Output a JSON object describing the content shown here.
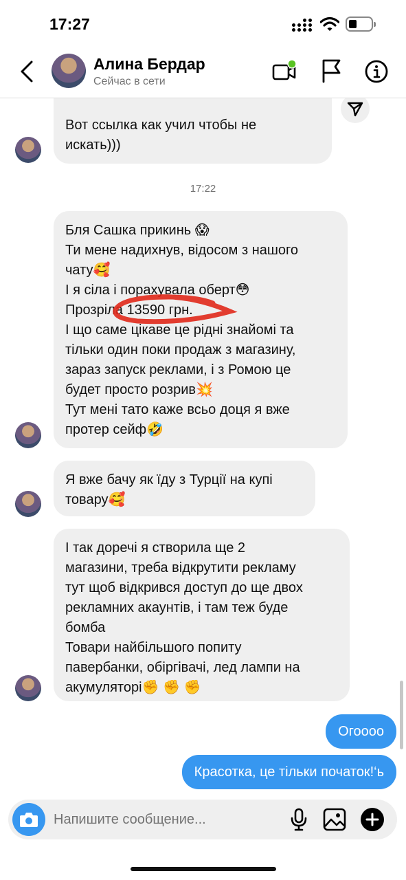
{
  "status_bar": {
    "time": "17:27"
  },
  "header": {
    "contact_name": "Алина Бердар",
    "contact_status": "Сейчас в сети",
    "online_color": "#58c322"
  },
  "messages": {
    "first_partial": "Вот ссылка как учил чтобы не\nискать)))",
    "timestamp": "17:22",
    "incoming": [
      "Бля Сашка прикинь 😱\nТи мене надихнув, відосом з нашого\nчату🥰\nІ я сіла і порахувала оберт😳\nПрозріла 13590 грн.\nІ що саме цікаве це рідні знайомі та\nтільки один поки продаж з магазину,\nзараз запуск реклами, і з Ромою це\nбудет просто розрив💥\nТут мені тато каже всьо доця я вже\nпротер сейф🤣",
      "Я вже бачу як їду з Турції на купі\nтовару🥰",
      "І так доречі я створила ще 2\nмагазини, треба відкрутити рекламу\nтут щоб відкрився доступ до ще двох\nрекламних акаунтів, і там теж буде\nбомба\nТовари найбільшого попиту\nпавербанки, обіргівачі, лед лампи на\nакумуляторі✊ ✊ ✊"
    ],
    "outgoing": [
      "Огоооо",
      "Красотка, це тільки початок!‘ь"
    ]
  },
  "composer": {
    "placeholder": "Напишите сообщение..."
  },
  "colors": {
    "outgoing_bubble": "#3797f0",
    "incoming_bubble": "#efefef",
    "highlight_oval": "#e0281a"
  },
  "icons": [
    "back-icon",
    "video-call-icon",
    "flag-icon",
    "info-icon",
    "share-icon",
    "camera-icon",
    "microphone-icon",
    "gallery-icon",
    "plus-icon"
  ]
}
